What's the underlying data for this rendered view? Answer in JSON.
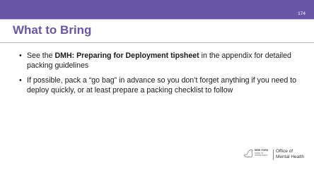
{
  "slide": {
    "page_number": "174",
    "title": "What to Bring",
    "bullets": [
      {
        "pre": "See the ",
        "bold": "DMH: Preparing for Deployment tipsheet",
        "post": " in the appendix for detailed packing guidelines"
      },
      {
        "text": "If possible, pack a “go bag” in advance so you don’t forget anything if you need to deploy quickly, or at least prepare a packing checklist to follow"
      }
    ],
    "bullet_glyph": "•"
  },
  "logo": {
    "state_name": "NEW YORK",
    "state_sub": "STATE OF\nOPPORTUNITY.",
    "office": "Office of\nMental Health",
    "icon": "new-york-state-outline-icon"
  },
  "colors": {
    "brand_purple": "#6a56a5",
    "text": "#1a1a1a"
  }
}
